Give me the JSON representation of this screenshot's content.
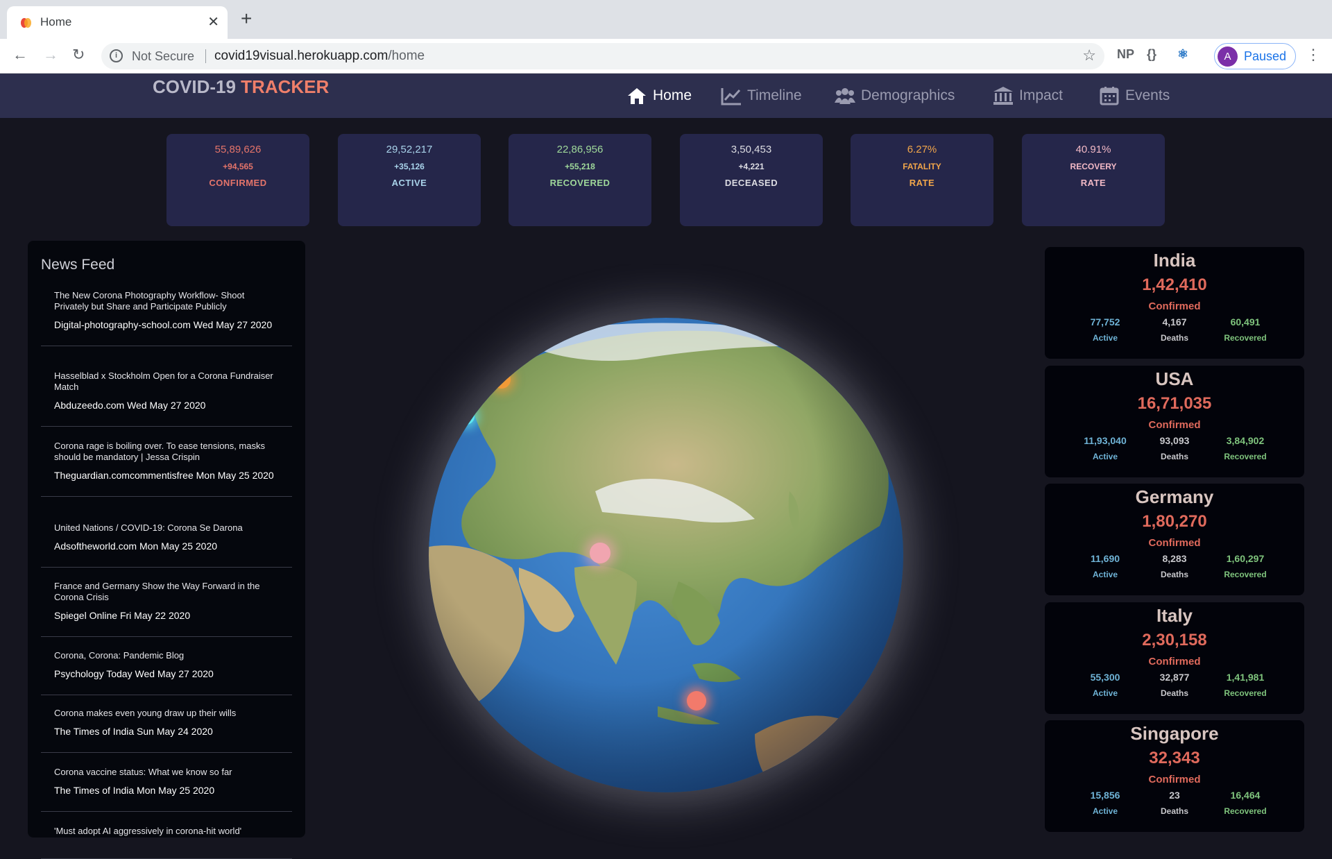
{
  "browser": {
    "tab_title": "Home",
    "not_secure": "Not Secure",
    "url_host": "covid19visual.herokuapp.com",
    "url_path": "/home",
    "profile_initial": "A",
    "profile_status": "Paused",
    "ext_np": "NP",
    "ext_braces": "{}"
  },
  "app": {
    "logo_main": "COVID-19",
    "logo_accent": "TRACKER",
    "nav": [
      "Home",
      "Timeline",
      "Demographics",
      "Impact",
      "Events"
    ]
  },
  "stats": [
    {
      "value": "55,89,626",
      "delta": "+94,565",
      "label": "CONFIRMED",
      "color": "#e4746a"
    },
    {
      "value": "29,52,217",
      "delta": "+35,126",
      "label": "ACTIVE",
      "color": "#a9d3ea"
    },
    {
      "value": "22,86,956",
      "delta": "+55,218",
      "label": "RECOVERED",
      "color": "#9fd89a"
    },
    {
      "value": "3,50,453",
      "delta": "+4,221",
      "label": "DECEASED",
      "color": "#dcdce2"
    },
    {
      "value": "6.27%",
      "delta": "FATALITY",
      "label": "RATE",
      "color": "#f2a64a"
    },
    {
      "value": "40.91%",
      "delta": "RECOVERY",
      "label": "RATE",
      "color": "#f2b9c6"
    }
  ],
  "news": {
    "title": "News Feed",
    "items": [
      {
        "headline": "The New Corona Photography Workflow- Shoot Privately but Share and Participate Publicly",
        "source": "Digital-photography-school.com Wed May 27 2020"
      },
      {
        "headline": "Hasselblad x Stockholm Open for a Corona Fundraiser Match",
        "source": "Abduzeedo.com Wed May 27 2020"
      },
      {
        "headline": "Corona rage is boiling over. To ease tensions, masks should be mandatory | Jessa Crispin",
        "source": "Theguardian.comcommentisfree Mon May 25 2020"
      },
      {
        "headline": "United Nations / COVID-19: Corona Se Darona",
        "source": "Adsoftheworld.com Mon May 25 2020"
      },
      {
        "headline": "France and Germany Show the Way Forward in the Corona Crisis",
        "source": "Spiegel Online Fri May 22 2020"
      },
      {
        "headline": "Corona, Corona: Pandemic Blog",
        "source": "Psychology Today Wed May 27 2020"
      },
      {
        "headline": "Corona makes even young draw up their wills",
        "source": "The Times of India Sun May 24 2020"
      },
      {
        "headline": "Corona vaccine status: What we know so far",
        "source": "The Times of India Mon May 25 2020"
      },
      {
        "headline": "'Must adopt AI aggressively in corona-hit world'",
        "source": ""
      }
    ]
  },
  "countries": [
    {
      "name": "India",
      "confirmed": "1,42,410",
      "confirmed_label": "Confirmed",
      "active": "77,752",
      "deaths": "4,167",
      "recovered": "60,491"
    },
    {
      "name": "USA",
      "confirmed": "16,71,035",
      "confirmed_label": "Confirmed",
      "active": "11,93,040",
      "deaths": "93,093",
      "recovered": "3,84,902"
    },
    {
      "name": "Germany",
      "confirmed": "1,80,270",
      "confirmed_label": "Confirmed",
      "active": "11,690",
      "deaths": "8,283",
      "recovered": "1,60,297"
    },
    {
      "name": "Italy",
      "confirmed": "2,30,158",
      "confirmed_label": "Confirmed",
      "active": "55,300",
      "deaths": "32,877",
      "recovered": "1,41,981"
    },
    {
      "name": "Singapore",
      "confirmed": "32,343",
      "confirmed_label": "Confirmed",
      "active": "15,856",
      "deaths": "23",
      "recovered": "16,464"
    }
  ],
  "country_labels": {
    "active": "Active",
    "deaths": "Deaths",
    "recovered": "Recovered"
  }
}
